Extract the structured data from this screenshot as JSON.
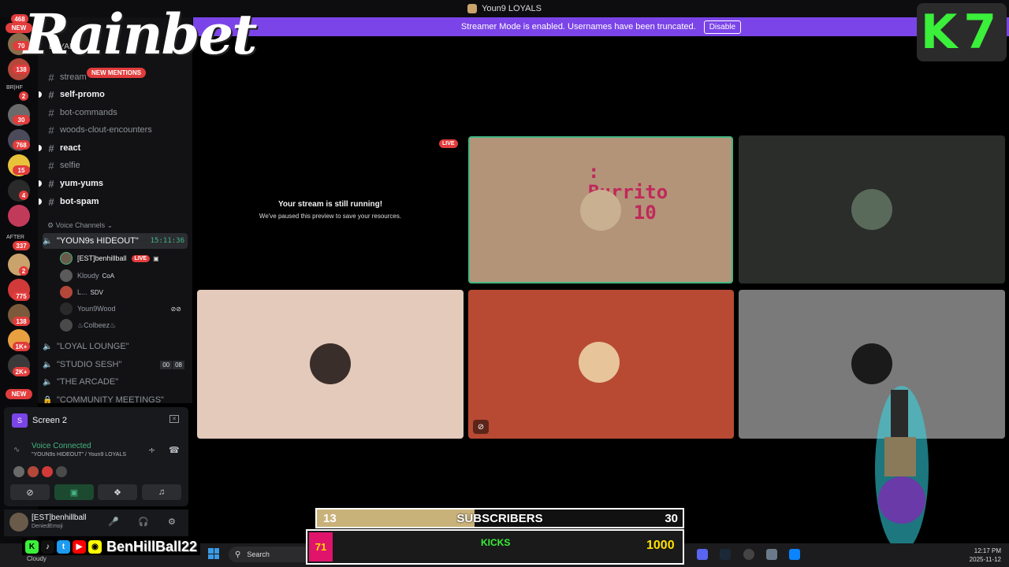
{
  "window": {
    "title": "Youn9 LOYALS"
  },
  "notice": {
    "text": "Streamer Mode is enabled. Usernames have been truncated.",
    "disable_label": "Disable"
  },
  "overlay": {
    "brand": "Rainbet",
    "corner_logo": "K7"
  },
  "rail": {
    "badges": [
      "468",
      "NEW",
      "70",
      "138",
      "2",
      "30",
      "768",
      "15",
      "4",
      "337",
      "2",
      "775",
      "138",
      "1K+",
      "2K+",
      "NEW"
    ],
    "labels": [
      "BR|HF",
      "AFTER"
    ]
  },
  "channels": {
    "server_name_fragment": "LOYALS",
    "mentions_label": "NEW MENTIONS",
    "text_channels": [
      {
        "name": "stream",
        "unread": false
      },
      {
        "name": "self-promo",
        "unread": true
      },
      {
        "name": "bot-commands",
        "unread": false
      },
      {
        "name": "woods-clout-encounters",
        "unread": false
      },
      {
        "name": "react",
        "unread": true
      },
      {
        "name": "selfie",
        "unread": false
      },
      {
        "name": "yum-yums",
        "unread": true
      },
      {
        "name": "bot-spam",
        "unread": true
      }
    ],
    "voice_category": "Voice Channels",
    "voice_channels": [
      {
        "name": "\"YOUN9s HIDEOUT\"",
        "time": "15:11:36"
      },
      {
        "name": "\"LOYAL LOUNGE\""
      },
      {
        "name": "\"STUDIO SESH\"",
        "counts": [
          "00",
          "08"
        ]
      },
      {
        "name": "\"THE ARCADE\""
      },
      {
        "name": "\"COMMUNITY MEETINGS\""
      }
    ],
    "members": [
      {
        "name": "[EST]benhillball",
        "badge": "LIVE",
        "self": true
      },
      {
        "name": "Kloudy",
        "tag": "CoA"
      },
      {
        "name": "L...",
        "tag": "SDV"
      },
      {
        "name": "Youn9Wood"
      },
      {
        "name": "♨Colbeez♨"
      }
    ]
  },
  "panel": {
    "screen_title": "Screen 2",
    "voice_connected": "Voice Connected",
    "voice_path": "\"YOUN9s HIDEOUT\" / Youn9 LOYALS"
  },
  "user": {
    "name": "[EST]benhillball",
    "status": "DeniedEmoji"
  },
  "stage": {
    "paused_title": "Your stream is still running!",
    "paused_sub": "We've paused this preview to save your resources.",
    "live_label": "LIVE",
    "burrito_text": ": \nBurrito\nnt: 10"
  },
  "subscribers": {
    "current": "13",
    "label": "SUBSCRIBERS",
    "goal": "30",
    "progress": 0.43
  },
  "taskbar": {
    "weather": "Cloudy",
    "search_label": "Search",
    "social_handle": "BenHillBall22",
    "stat_left": "71",
    "stat_kicks": "KICKS",
    "stat_right": "1000",
    "time": "12:17 PM",
    "date": "2025-11-12"
  },
  "colors": {
    "accent": "#7b44e8",
    "live_red": "#e23c3c",
    "voice_green": "#43b581",
    "k7_green": "#3af03a"
  }
}
